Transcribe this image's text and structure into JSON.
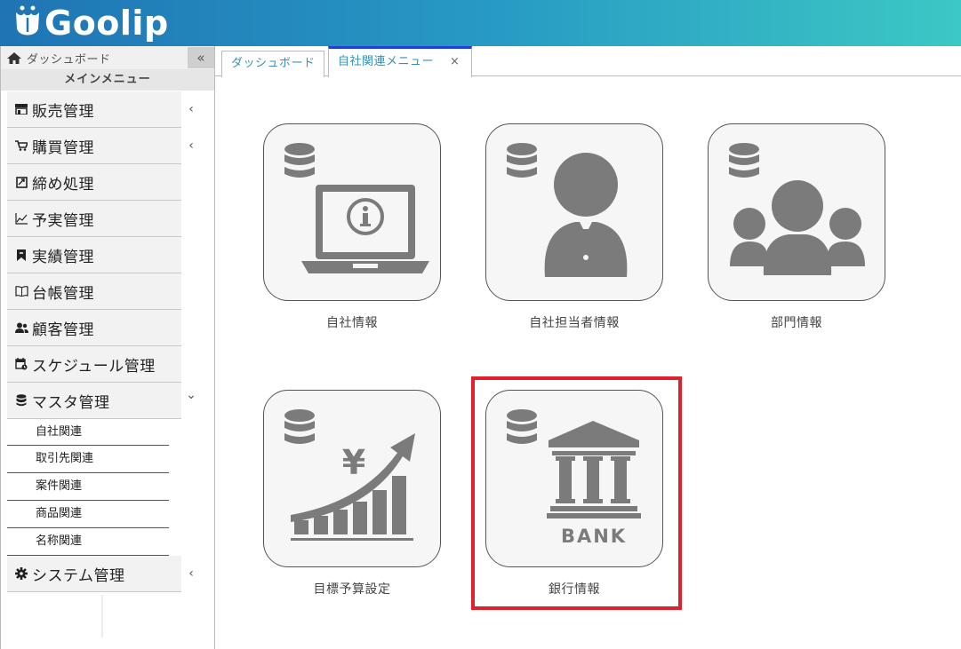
{
  "app": {
    "logo_text": "Goolip"
  },
  "sidebar": {
    "home_label": "ダッシュボード",
    "collapse_glyph": "«",
    "title": "メインメニュー",
    "items": [
      {
        "label": "販売管理",
        "icon": "store-icon",
        "chevron": "‹"
      },
      {
        "label": "購買管理",
        "icon": "cart-icon",
        "chevron": "‹"
      },
      {
        "label": "締め処理",
        "icon": "checkbox-icon",
        "chevron": ""
      },
      {
        "label": "予実管理",
        "icon": "line-chart-icon",
        "chevron": ""
      },
      {
        "label": "実績管理",
        "icon": "bookmark-icon",
        "chevron": ""
      },
      {
        "label": "台帳管理",
        "icon": "book-icon",
        "chevron": ""
      },
      {
        "label": "顧客管理",
        "icon": "users-icon",
        "chevron": ""
      },
      {
        "label": "スケジュール管理",
        "icon": "calendar-icon",
        "chevron": ""
      },
      {
        "label": "マスタ管理",
        "icon": "database-icon",
        "chevron": "⌄"
      }
    ],
    "submenu": [
      "自社関連",
      "取引先関連",
      "案件関連",
      "商品関連",
      "名称関連"
    ],
    "system": {
      "label": "システム管理",
      "icon": "gear-icon",
      "chevron": "‹"
    }
  },
  "tabs": [
    {
      "label": "ダッシュボード",
      "active": false
    },
    {
      "label": "自社関連メニュー",
      "active": true,
      "close": "×"
    }
  ],
  "tiles": [
    {
      "label": "自社情報",
      "icon": "laptop-info-icon"
    },
    {
      "label": "自社担当者情報",
      "icon": "person-icon"
    },
    {
      "label": "部門情報",
      "icon": "group-icon"
    },
    {
      "label": "目標予算設定",
      "icon": "yen-growth-chart-icon",
      "glyph": "¥"
    },
    {
      "label": "銀行情報",
      "icon": "bank-icon",
      "glyph": "BANK",
      "highlighted": true
    }
  ],
  "colors": {
    "header_start": "#1f74b4",
    "header_end": "#3cc8c4",
    "icon_gray": "#7b7b7b",
    "highlight": "#e0212b",
    "active_tab": "#1f3fd6"
  }
}
